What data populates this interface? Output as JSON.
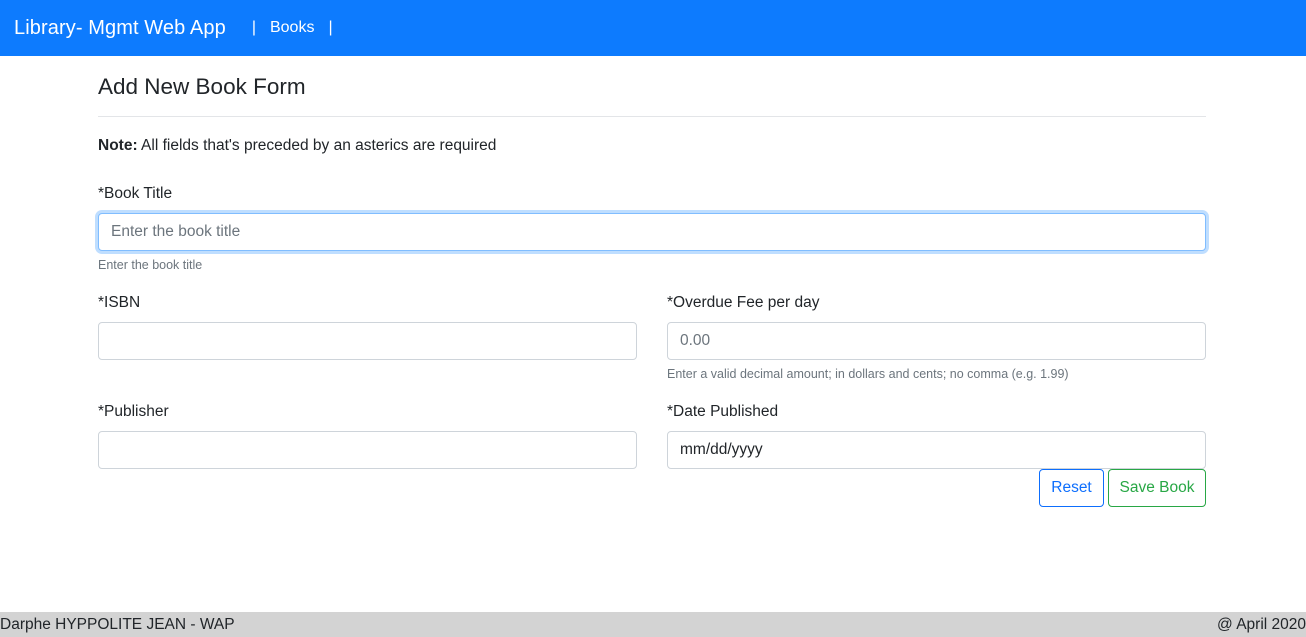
{
  "navbar": {
    "brand": "Library- Mgmt Web App",
    "separator": "|",
    "links": [
      {
        "label": "Books"
      }
    ],
    "background": "#0d7bfe"
  },
  "form": {
    "title": "Add New Book Form",
    "note_bold": "Note:",
    "note_text": " All fields that's preceded by an asterics are required",
    "fields": {
      "book_title": {
        "label": "*Book Title",
        "placeholder": "Enter the book title",
        "value": "",
        "help": "Enter the book title"
      },
      "isbn": {
        "label": "*ISBN",
        "placeholder": "",
        "value": ""
      },
      "overdue_fee": {
        "label": "*Overdue Fee per day",
        "placeholder": "0.00",
        "value": "",
        "help": "Enter a valid decimal amount; in dollars and cents; no comma (e.g. 1.99)"
      },
      "publisher": {
        "label": "*Publisher",
        "placeholder": "",
        "value": ""
      },
      "date_published": {
        "label": "*Date Published",
        "placeholder": "mm/dd/yyyy",
        "value": ""
      }
    },
    "buttons": {
      "reset": "Reset",
      "save": "Save Book"
    }
  },
  "footer": {
    "left": "Darphe HYPPOLITE JEAN - WAP",
    "right": "@ April 2020"
  }
}
